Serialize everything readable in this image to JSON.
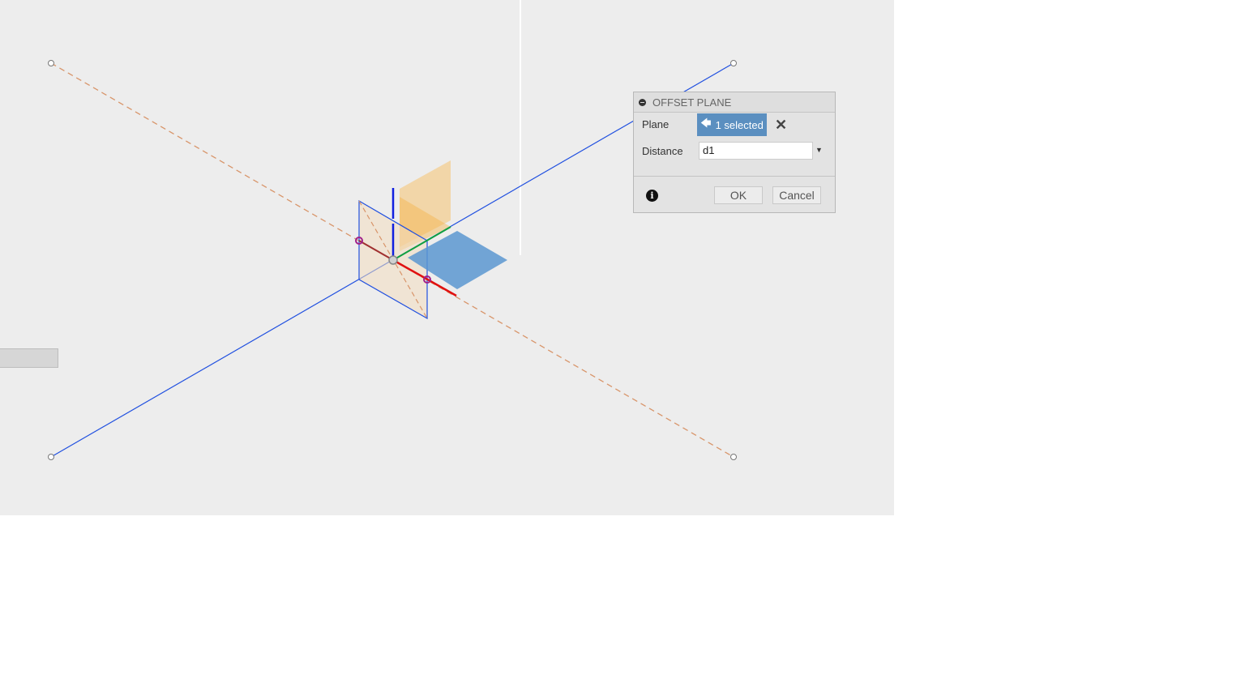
{
  "dialog": {
    "title": "OFFSET PLANE",
    "plane_label": "Plane",
    "plane_selection": "1 selected",
    "distance_label": "Distance",
    "distance_value": "d1",
    "ok_label": "OK",
    "cancel_label": "Cancel",
    "icons": {
      "collapse": "minus-circle-icon",
      "select": "cursor-arrow-icon",
      "clear": "close-icon",
      "dropdown": "chevron-down-icon",
      "info": "info-icon"
    }
  },
  "colors": {
    "viewport_bg": "#ededed",
    "selection": "#5b8fc0",
    "axis_x": "#e01010",
    "axis_y": "#10a040",
    "axis_z": "#1020e0"
  }
}
